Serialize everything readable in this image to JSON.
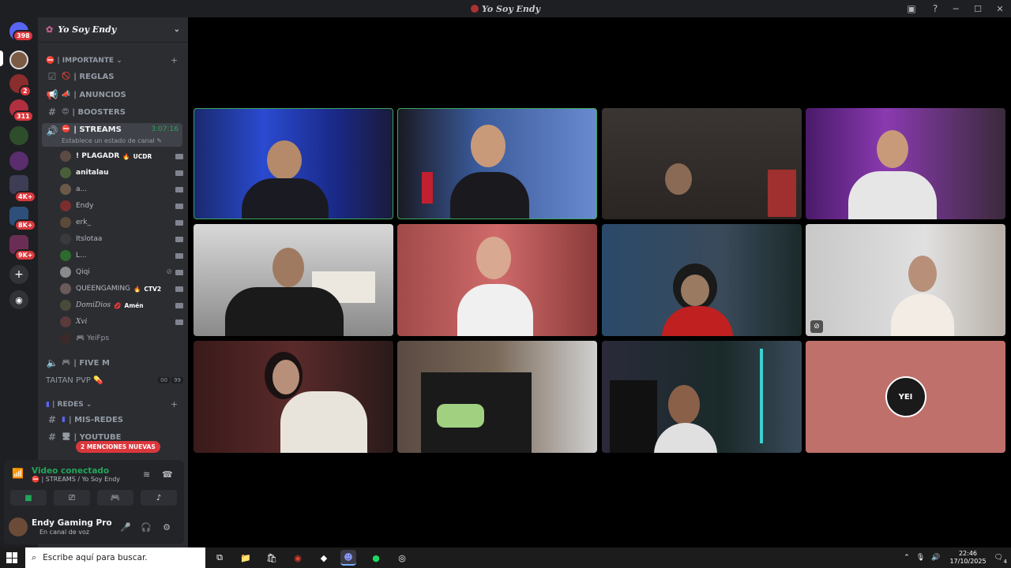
{
  "window": {
    "title": "Yo Soy Endy",
    "controls": [
      "─",
      "☐",
      "✕"
    ]
  },
  "servers": {
    "badges": [
      "398",
      "2",
      "311",
      "4K+",
      "8K+",
      "9K+"
    ]
  },
  "guild": {
    "name": "Yo Soy Endy",
    "categories": {
      "importante": "| IMPORTANTE",
      "redes": "| REDES"
    },
    "channels": [
      {
        "label": "| REGLAS"
      },
      {
        "label": "| ANUNCIOS"
      },
      {
        "label": "| BOOSTERS"
      },
      {
        "label": "| STREAMS",
        "timer": "3:07:16"
      },
      {
        "label": "| FIVE M"
      },
      {
        "label": "TAITAN PVP",
        "counts": [
          "00",
          "99"
        ]
      },
      {
        "label": "| MIS-REDES"
      },
      {
        "label": "| YOUTUBE"
      }
    ],
    "status_line": "Establece un estado de canal",
    "voice_users": [
      {
        "name": "! PLAGADR",
        "tag": "UCDR"
      },
      {
        "name": "anitalau"
      },
      {
        "name": "a..."
      },
      {
        "name": "Endy"
      },
      {
        "name": "erk_"
      },
      {
        "name": "Itslotaa"
      },
      {
        "name": "L..."
      },
      {
        "name": "Qiqi"
      },
      {
        "name": "QUEENGAMING",
        "tag": "CTV2"
      },
      {
        "name": "DomiDios",
        "tag": "Amén"
      },
      {
        "name": "Xvi"
      },
      {
        "name": "YeiFps"
      }
    ],
    "mentions_badge": "2 MENCIONES NUEVAS"
  },
  "voice_panel": {
    "title": "Video conectado",
    "subtitle": "| STREAMS / Yo Soy Endy",
    "user_name": "Endy Gaming Pro",
    "user_status": "En canal de voz"
  },
  "stage": {
    "avatar_label": "YEI"
  },
  "taskbar": {
    "search_placeholder": "Escribe aquí para buscar.",
    "time": "22:46",
    "date": "17/10/2025",
    "notif_count": "4"
  }
}
